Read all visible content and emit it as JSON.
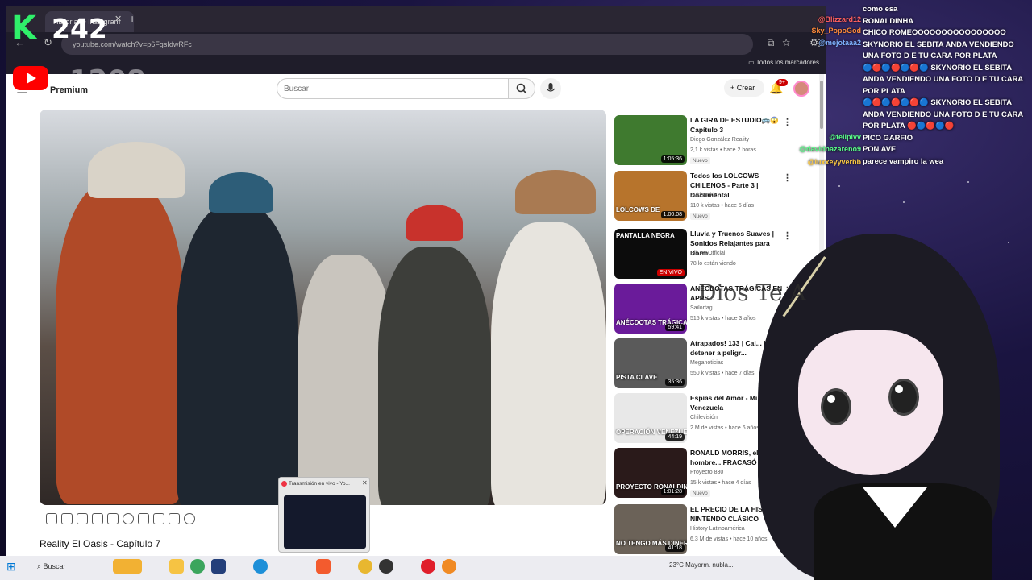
{
  "overlay": {
    "logo_letter": "K",
    "logo_number": "242",
    "logo_ghost": "1208",
    "floating_text": "Dios Te A"
  },
  "browser": {
    "tab_title": "Historias • Instagram",
    "url": "youtube.com/watch?v=p6FgsIdwRFc",
    "bookmarks_label": "Todos los marcadores"
  },
  "youtube": {
    "logo_label": "Premium",
    "search_placeholder": "Buscar",
    "create_label": "Crear",
    "notifications_count": "9+",
    "video_title": "Reality El Oasis - Capítulo 7"
  },
  "recommendations": [
    {
      "title": "LA GIRA DE ESTUDIO🚌😱 Capítulo 3",
      "channel": "Diego González Reality",
      "views": "2,1 k vistas • hace 2 horas",
      "duration": "1:05:36",
      "badge": "Nuevo",
      "thumb_text": "",
      "thumb_color": "#3f7a2f"
    },
    {
      "title": "Todos los LOLCOWS CHILENOS - Parte 3 | Documental",
      "channel": "Zukistrukiz",
      "views": "110 k vistas • hace 5 días",
      "duration": "1:00:08",
      "badge": "Nuevo",
      "thumb_text": "LOLCOWS DE",
      "thumb_color": "#b7742c"
    },
    {
      "title": "Lluvia y Truenos Suaves | Sonidos Relajantes para Dorm...",
      "channel": "Bih An Official",
      "views": "78 lo están viendo",
      "duration": "EN VIVO",
      "badge": "",
      "thumb_text": "PANTALLA NEGRA",
      "thumb_color": "#0c0c0c"
    },
    {
      "title": "ANÉCDOTAS TRÁGICAS EN APPS...",
      "channel": "Sailorfag",
      "views": "515 k vistas • hace 3 años",
      "duration": "59:41",
      "badge": "",
      "thumb_text": "ANÉCDOTAS TRÁGICAS",
      "thumb_color": "#6a1b9a"
    },
    {
      "title": "Atrapados! 133 | Cai... logra detener a peligr...",
      "channel": "Meganoticias",
      "views": "550 k vistas • hace 7 días",
      "duration": "35:36",
      "badge": "",
      "thumb_text": "PISTA CLAVE",
      "thumb_color": "#5a5a5a"
    },
    {
      "title": "Espías del Amor - Mi via... Venezuela",
      "channel": "Chilevisión",
      "views": "2 M de vistas • hace 6 años",
      "duration": "44:19",
      "badge": "",
      "thumb_text": "OPERACIÓN VENEZUELA",
      "thumb_color": "#e8e8e8"
    },
    {
      "title": "RONALD MORRIS, el hombre... FRACASÓ en TODO",
      "channel": "Proyecto 830",
      "views": "15 k vistas • hace 4 días",
      "duration": "1:01:28",
      "badge": "Nuevo",
      "thumb_text": "PROYECTO RONALDINO",
      "thumb_color": "#2a1a1a"
    },
    {
      "title": "EL PRECIO DE LA HISTORIA: NINTENDO CLÁSICO",
      "channel": "History Latinoamérica",
      "views": "6.3 M de vistas • hace 10 años",
      "duration": "41:18",
      "badge": "",
      "thumb_text": "NO TENGO MÁS DINERO",
      "thumb_color": "#6b6258"
    }
  ],
  "mini_popup": {
    "title": "Transmisión en vivo - Yo..."
  },
  "taskbar": {
    "search_label": "Buscar",
    "weather": "23°C  Mayorm. nubla..."
  },
  "chat": {
    "lines": [
      "como esa",
      "RONALDINHA",
      "CHICO ROMEOOOOOOOOOOOOOOOO",
      "SKYNORIO EL SEBITA ANDA VENDIENDO UNA FOTO D E TU CARA POR PLATA",
      "🔵🔴🔵🔴🔵🔴🔵 SKYNORIO EL SEBITA ANDA VENDIENDO UNA FOTO D E TU CARA POR PLATA",
      "🔵🔴🔵🔴🔵🔴🔵 SKYNORIO EL SEBITA ANDA VENDIENDO UNA FOTO D E TU CARA POR PLATA 🔴🔵🔴🔵🔴",
      "PICO GARFIO",
      "PON AVE",
      "parece vampiro la wea"
    ],
    "users": [
      {
        "name": "@Blizzard12",
        "color": "#ff6060"
      },
      {
        "name": "Sky_PopoGod",
        "color": "#ff8a3a"
      },
      {
        "name": "@mejotaaa2",
        "color": "#7fb2ff"
      },
      {
        "name": "@felipivv",
        "color": "#5aff8a"
      },
      {
        "name": "@davidnazareno9",
        "color": "#5aff8a"
      },
      {
        "name": "@luxxeyyverbb",
        "color": "#ffcc44"
      }
    ]
  }
}
